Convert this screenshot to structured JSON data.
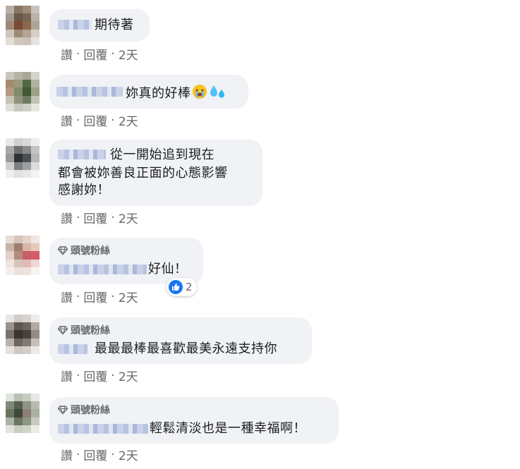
{
  "comments": [
    {
      "badge": "",
      "text": "期待著",
      "actions": {
        "like": "讚",
        "reply": "回覆",
        "time": "2天"
      }
    },
    {
      "badge": "",
      "text": "妳真的好棒",
      "emojis": [
        "crying-face-emoji",
        "sweat-droplets-emoji"
      ],
      "actions": {
        "like": "讚",
        "reply": "回覆",
        "time": "2天"
      }
    },
    {
      "badge": "",
      "text_lines": [
        "從一開始追到現在",
        "都會被妳善良正面的心態影響",
        "感謝妳！"
      ],
      "actions": {
        "like": "讚",
        "reply": "回覆",
        "time": "2天"
      }
    },
    {
      "badge": "頭號粉絲",
      "text": "好仙！",
      "reactions": {
        "icon": "like-reaction-icon",
        "count": "2"
      },
      "actions": {
        "like": "讚",
        "reply": "回覆",
        "time": "2天"
      }
    },
    {
      "badge": "頭號粉絲",
      "text": "最最最棒最喜歡最美永遠支持你",
      "actions": {
        "like": "讚",
        "reply": "回覆",
        "time": "2天"
      }
    },
    {
      "badge": "頭號粉絲",
      "text": "輕鬆清淡也是一種幸福啊！",
      "actions": {
        "like": "讚",
        "reply": "回覆",
        "time": "2天"
      }
    }
  ],
  "separator": "·",
  "colors": {
    "bubble": "#f0f2f5",
    "meta": "#65676b",
    "like_blue": "#1877f2"
  }
}
